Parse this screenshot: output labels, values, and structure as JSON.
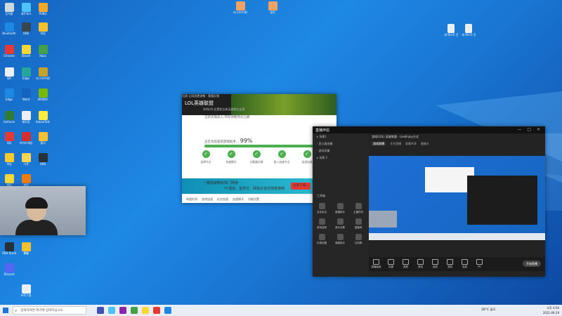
{
  "desktop_icons": [
    {
      "label": "휴지통",
      "color": "#cfd8dc"
    },
    {
      "label": "네트워크",
      "color": "#4fc3f7"
    },
    {
      "label": "PUBG",
      "color": "#f9a825"
    },
    {
      "label": "Bluetooth",
      "color": "#1e88e5"
    },
    {
      "label": "OBS",
      "color": "#37474f"
    },
    {
      "label": "파일",
      "color": "#fbc02d"
    },
    {
      "label": "Chrome",
      "color": "#e53935"
    },
    {
      "label": "Steam",
      "color": "#fdd835"
    },
    {
      "label": "Xbox",
      "color": "#43a047"
    },
    {
      "label": "QR",
      "color": "#eceff1"
    },
    {
      "label": "Edge",
      "color": "#26a69a"
    },
    {
      "label": "리그오브레전드",
      "color": "#c9a227"
    },
    {
      "label": "Edge",
      "color": "#1e88e5"
    },
    {
      "label": "Word",
      "color": "#1565c0"
    },
    {
      "label": "NVIDIA",
      "color": "#76b900"
    },
    {
      "label": "GeForce",
      "color": "#2e7d32"
    },
    {
      "label": "메모장",
      "color": "#eceff1"
    },
    {
      "label": "KakaoTalk",
      "color": "#ffeb3b"
    },
    {
      "label": "QQ",
      "color": "#e53935"
    },
    {
      "label": "카카오게임",
      "color": "#d32f2f"
    },
    {
      "label": "폴더",
      "color": "#fbc02d"
    },
    {
      "label": "파일",
      "color": "#ffca28"
    },
    {
      "label": "시작",
      "color": "#ffd54f"
    },
    {
      "label": "OBS",
      "color": "#263238"
    },
    {
      "label": "게임",
      "color": "#fdd835"
    },
    {
      "label": "게임",
      "color": "#f57c00"
    },
    {
      "label": "OBS Studio",
      "color": "#263238"
    },
    {
      "label": "문서",
      "color": "#fbc02d"
    },
    {
      "label": "Discord",
      "color": "#5865f2"
    },
    {
      "label": "파일",
      "color": "#fbc02d"
    },
    {
      "label": "프로그램",
      "color": "#eceff1"
    }
  ],
  "top_icons": [
    {
      "label": "리그오브레전드",
      "color": "#f4a261"
    },
    {
      "label": "설치",
      "color": "#f4a261"
    }
  ],
  "right_icons": [
    {
      "label": "새 텍스트 문서",
      "color": "#eceff1"
    },
    {
      "label": "새 텍스트 문서",
      "color": "#eceff1"
    }
  ],
  "installer": {
    "titlebar": "迅游 让网游更流畅 · 客服反馈",
    "banner_title": "LOL英雄联盟",
    "banner_sub": "你的LOL位置和全新英雄都在这里",
    "subtitle": "全新英雄加入,带你领略顶尖之巅",
    "progress_label": "正在为您安装游戏助手...",
    "progress_value": "99%",
    "progress_fraction": 0.99,
    "steps": [
      "选择节点",
      "加速模式",
      "分解器存储",
      "接入加速节点",
      "连接加速"
    ],
    "ad_title": "一键加速畅玩热门网游",
    "ad_sub": "YY语音、宜传艺、网易云音乐随意使用",
    "ad_button": "立即下载 ›",
    "bottom_links": [
      "网速检测",
      "游戏加速",
      "反应加速",
      "加速模式",
      "功能设置"
    ],
    "accent": "#4caf50"
  },
  "app": {
    "title": "直播伴侣",
    "window_controls": "— □ ✕",
    "info": "游戏(LOL)  英雄联盟  ·  LiveEnjoy方式",
    "tabs": [
      "游戏直播",
      "才艺直播",
      "屏幕共享",
      "摄像头"
    ],
    "scenes": [
      "▸ 场景1",
      "· 显示器采集",
      "· 游戏采集",
      "▸ 场景 2"
    ],
    "toolbox_label": "工具箱",
    "tools": [
      "互动玩法",
      "直播助手",
      "主播任务",
      "游戏选择",
      "音乐点歌",
      "直播间",
      "礼物设置",
      "弹幕助手",
      "互动等"
    ],
    "bottom_buttons": [
      "直播画面",
      "设置",
      "美颜",
      "音效",
      "画质",
      "录制",
      "连麦",
      "PK"
    ],
    "go_live": "开始直播"
  },
  "taskbar": {
    "search_placeholder": "검색하려면 여기에 입력하십시오.",
    "weather": "28°C  습도",
    "time": "오후 4:56",
    "date": "2021-09-29",
    "app_colors": [
      "#3f51b5",
      "#4fc3f7",
      "#8e24aa",
      "#43a047",
      "#fdd835",
      "#e53935",
      "#1e88e5"
    ]
  }
}
